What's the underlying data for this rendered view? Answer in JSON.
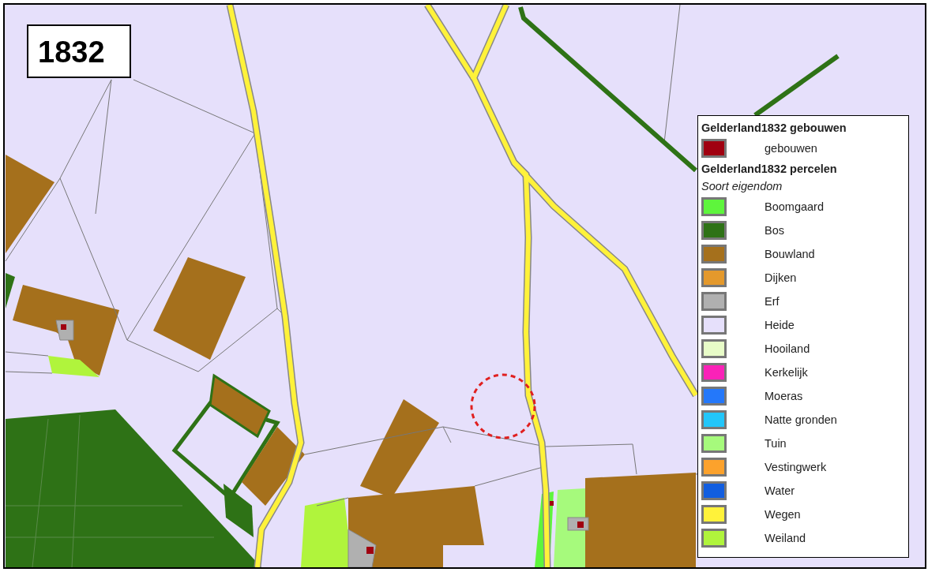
{
  "year_label": "1832",
  "legend": {
    "groups": [
      {
        "title": "Gelderland1832 gebouwen",
        "items": [
          {
            "label": "gebouwen",
            "color": "#a00010"
          }
        ]
      },
      {
        "title": "Gelderland1832 percelen",
        "subtitle": "Soort eigendom",
        "items": [
          {
            "label": "Boomgaard",
            "color": "#5ef53c"
          },
          {
            "label": "Bos",
            "color": "#2e7216"
          },
          {
            "label": "Bouwland",
            "color": "#a5701c"
          },
          {
            "label": "Dijken",
            "color": "#e4992c"
          },
          {
            "label": "Erf",
            "color": "#b0b0b0"
          },
          {
            "label": "Heide",
            "color": "#e6e0fb"
          },
          {
            "label": "Hooiland",
            "color": "#e8fcc8"
          },
          {
            "label": "Kerkelijk",
            "color": "#fa22b8"
          },
          {
            "label": "Moeras",
            "color": "#2478fa"
          },
          {
            "label": "Natte gronden",
            "color": "#22c6fa"
          },
          {
            "label": "Tuin",
            "color": "#a6fa7c"
          },
          {
            "label": "Vestingwerk",
            "color": "#fca22c"
          },
          {
            "label": "Water",
            "color": "#125ee0"
          },
          {
            "label": "Wegen",
            "color": "#fff23a"
          },
          {
            "label": "Weiland",
            "color": "#b0f43c"
          }
        ]
      }
    ]
  }
}
